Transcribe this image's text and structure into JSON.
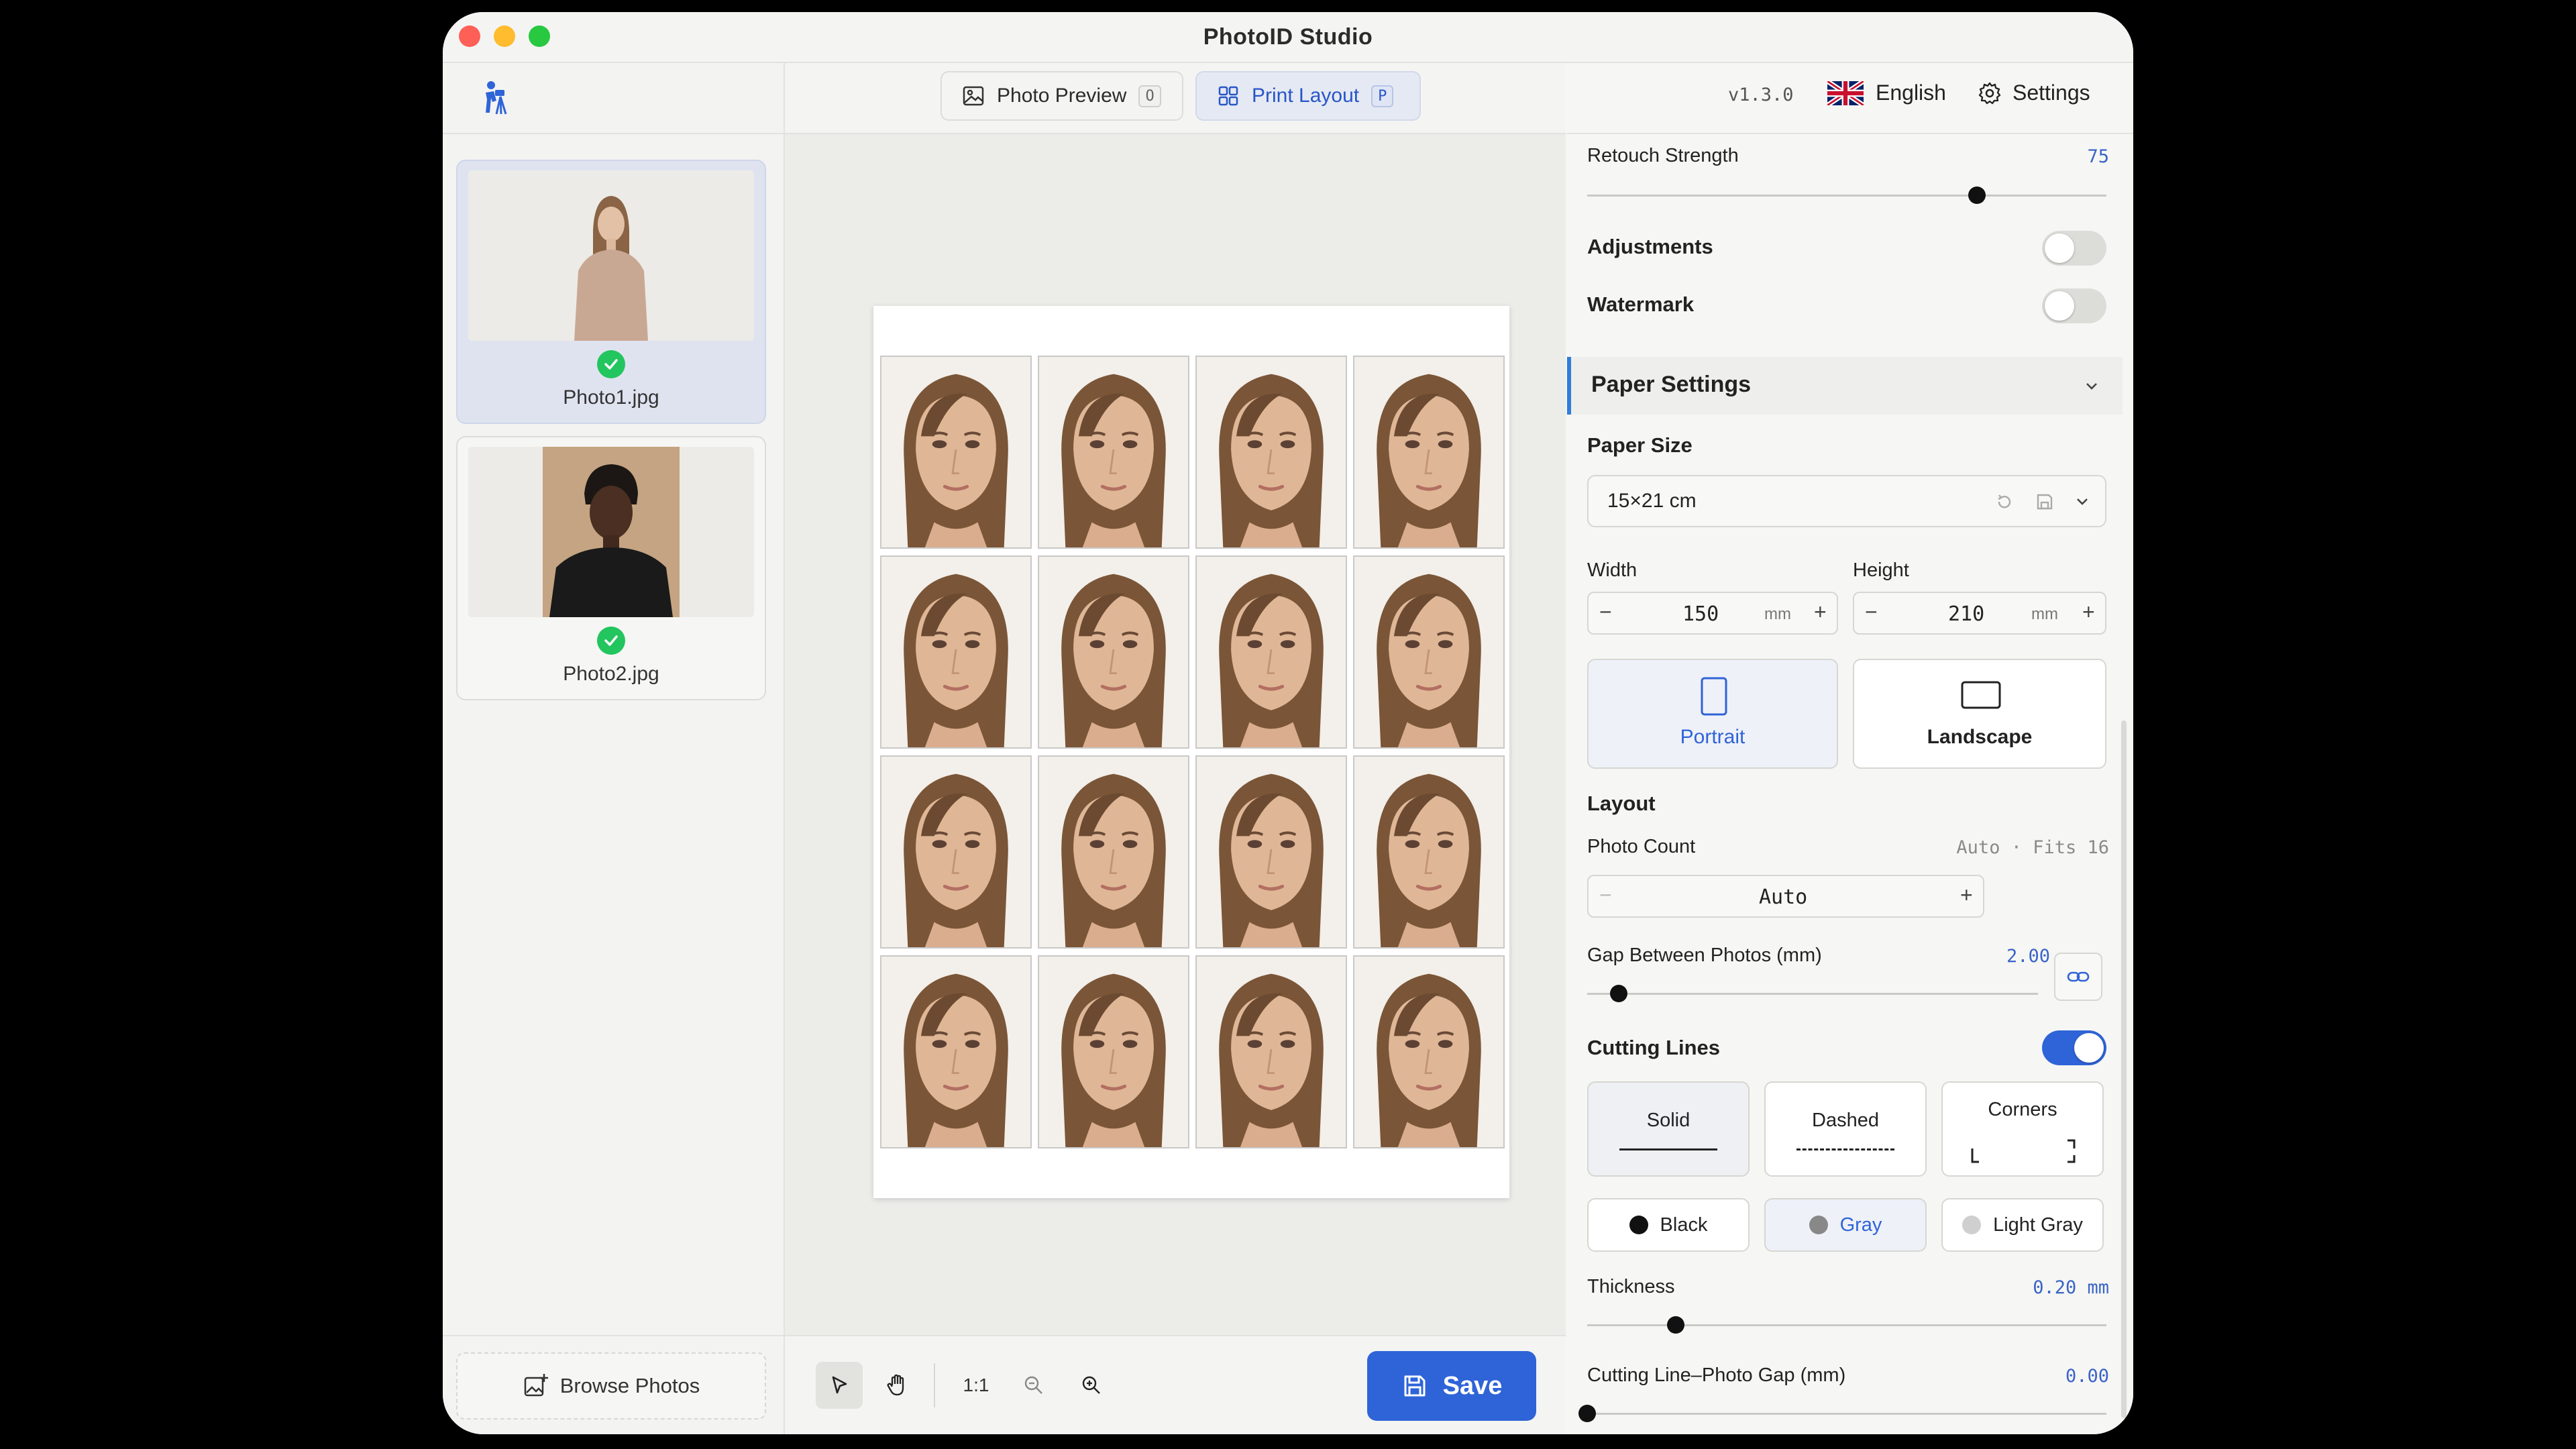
{
  "window": {
    "title": "PhotoID Studio"
  },
  "colors": {
    "accent": "#2f64d8",
    "success": "#22c55e",
    "section_accent": "#2f7dd8"
  },
  "sidebar": {
    "photos": [
      {
        "name": "Photo1.jpg",
        "status": "done",
        "selected": true
      },
      {
        "name": "Photo2.jpg",
        "status": "done",
        "selected": false
      }
    ],
    "browse_label": "Browse Photos"
  },
  "toolbar": {
    "tabs": [
      {
        "label": "Photo Preview",
        "shortcut": "O",
        "active": false
      },
      {
        "label": "Print Layout",
        "shortcut": "P",
        "active": true
      }
    ],
    "zoom_reset_label": "1:1",
    "save_label": "Save"
  },
  "header": {
    "version": "v1.3.0",
    "language": "English",
    "settings_label": "Settings"
  },
  "panel": {
    "retouch": {
      "label": "Retouch Strength",
      "value": "75",
      "level": 75
    },
    "adjustments": {
      "label": "Adjustments",
      "on": false
    },
    "watermark": {
      "label": "Watermark",
      "on": false
    },
    "paper_section_title": "Paper Settings",
    "paper_size": {
      "label": "Paper Size",
      "value": "15×21 cm"
    },
    "width": {
      "label": "Width",
      "value": "150",
      "unit": "mm"
    },
    "height": {
      "label": "Height",
      "value": "210",
      "unit": "mm"
    },
    "orientation": {
      "portrait": "Portrait",
      "landscape": "Landscape",
      "selected": "portrait"
    },
    "layout_title": "Layout",
    "photo_count": {
      "label": "Photo Count",
      "hint": "Auto · Fits 16",
      "value": "Auto"
    },
    "gap": {
      "label": "Gap Between Photos (mm)",
      "value": "2.00",
      "level": 0.07
    },
    "cutting_lines": {
      "label": "Cutting Lines",
      "on": true
    },
    "line_styles": {
      "solid": "Solid",
      "dashed": "Dashed",
      "corners": "Corners",
      "selected": "solid"
    },
    "line_colors": {
      "black": "Black",
      "gray": "Gray",
      "light_gray": "Light Gray",
      "selected": "gray"
    },
    "thickness": {
      "label": "Thickness",
      "value": "0.20 mm",
      "level": 0.17
    },
    "line_gap": {
      "label": "Cutting Line–Photo Gap (mm)",
      "value": "0.00",
      "level": 0.0
    }
  },
  "layout_preview": {
    "rows": 4,
    "cols": 4
  }
}
